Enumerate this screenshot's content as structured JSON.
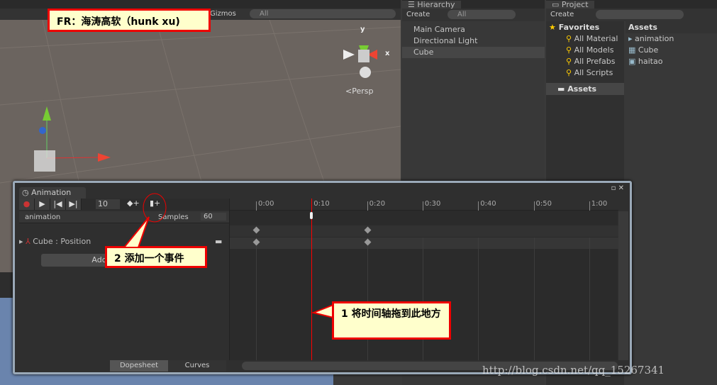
{
  "scene": {
    "gizmos_label": "Gizmos",
    "search_placeholder": "All",
    "persp_label": "Persp",
    "axis_x": "x",
    "axis_y": "y"
  },
  "hierarchy": {
    "title": "Hierarchy",
    "create_label": "Create",
    "search_placeholder": "All",
    "items": [
      "Main Camera",
      "Directional Light",
      "Cube"
    ],
    "selected": "Cube"
  },
  "project": {
    "title": "Project",
    "create_label": "Create",
    "favorites_label": "Favorites",
    "favorites": [
      "All Material",
      "All Models",
      "All Prefabs",
      "All Scripts"
    ],
    "assets_folder": "Assets",
    "assets_header": "Assets",
    "assets": [
      "animation",
      "Cube",
      "haitao"
    ]
  },
  "animation": {
    "tab_label": "Animation",
    "frame": "10",
    "clip_name": "animation",
    "samples_label": "Samples",
    "samples": "60",
    "property": "Cube : Position",
    "add_curve_label": "Add Curve",
    "ticks": [
      "0:00",
      "0:10",
      "0:20",
      "0:30",
      "0:40",
      "0:50",
      "1:00"
    ],
    "current_time": "0:10",
    "keyframes": [
      "0:00",
      "0:20"
    ],
    "dopesheet_label": "Dopesheet",
    "curves_label": "Curves"
  },
  "annotations": {
    "author": "FR：海涛高软（hunk xu)",
    "step1": "1 将时间轴拖到此地方",
    "step2": "2 添加一个事件",
    "accent": "#ff0000",
    "callout_bg": "#ffffcc"
  },
  "watermark": "http://blog.csdn.net/qq_15267341"
}
